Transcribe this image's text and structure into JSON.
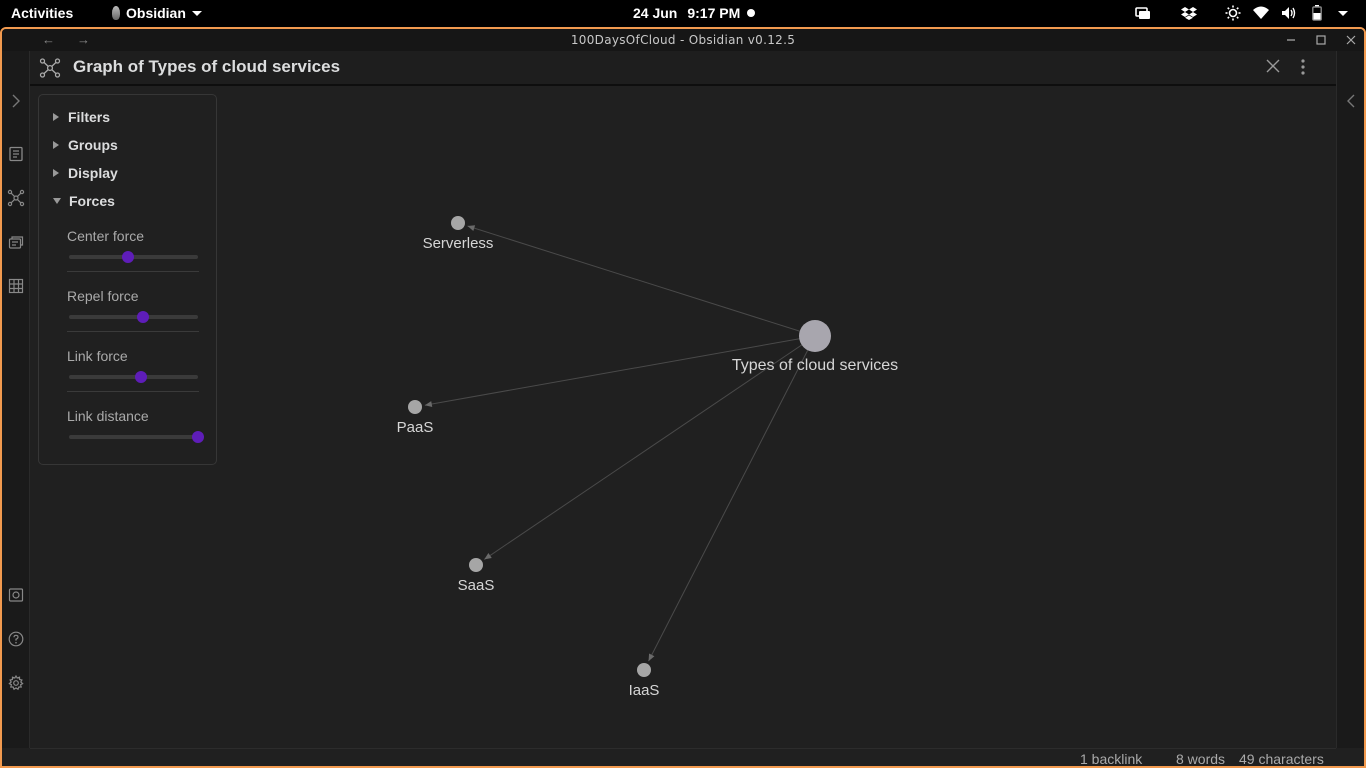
{
  "topbar": {
    "activities": "Activities",
    "app_name": "Obsidian",
    "date": "24 Jun",
    "time": "9:17 PM"
  },
  "window": {
    "title": "100DaysOfCloud - Obsidian v0.12.5"
  },
  "pane": {
    "title": "Graph of Types of cloud services"
  },
  "controls": {
    "sections": [
      "Filters",
      "Groups",
      "Display",
      "Forces"
    ],
    "forces": [
      {
        "label": "Center force",
        "value": 0.46
      },
      {
        "label": "Repel force",
        "value": 0.57
      },
      {
        "label": "Link force",
        "value": 0.56
      },
      {
        "label": "Link distance",
        "value": 1.0
      }
    ]
  },
  "graph": {
    "center": {
      "label": "Types of cloud services"
    },
    "nodes": [
      {
        "label": "Serverless"
      },
      {
        "label": "PaaS"
      },
      {
        "label": "SaaS"
      },
      {
        "label": "IaaS"
      }
    ]
  },
  "statusbar": {
    "backlinks": "1 backlink",
    "words": "8 words",
    "characters": "49 characters"
  },
  "colors": {
    "accent": "#5e1db8",
    "window_border": "#f29a4f",
    "node": "#a6a6a6",
    "background": "#202020"
  },
  "icons": {
    "ribbon": [
      "chevron-right-icon",
      "open-switcher-icon",
      "graph-view-icon",
      "templates-icon",
      "starter-kit-icon",
      "vault-icon",
      "help-icon",
      "settings-icon"
    ],
    "tray": [
      "display-icon",
      "dropbox-icon",
      "brightness-icon",
      "wifi-icon",
      "volume-icon",
      "battery-icon",
      "chevron-down-icon"
    ]
  }
}
